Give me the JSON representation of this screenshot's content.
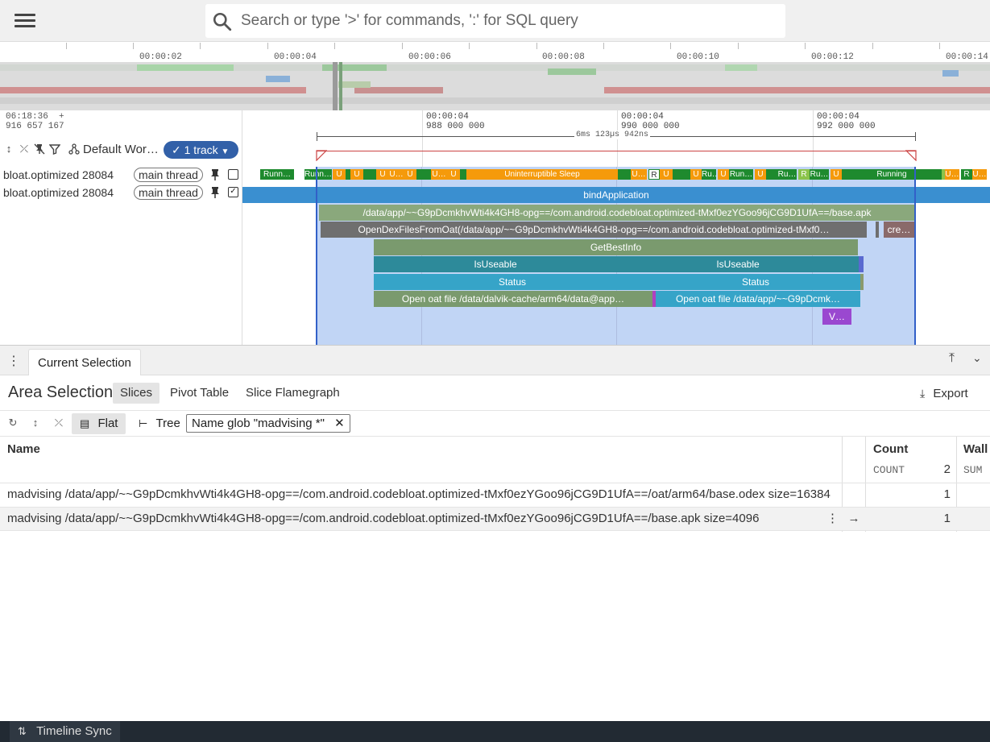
{
  "search": {
    "placeholder": "Search or type '>' for commands, ':' for SQL query"
  },
  "overview": {
    "time_labels": [
      "00:00:02",
      "00:00:04",
      "00:00:06",
      "00:00:08",
      "00:00:10",
      "00:00:12",
      "00:00:14"
    ]
  },
  "header": {
    "time_top": "06:18:36",
    "time_plus": "+",
    "time_ns": "916 657 167",
    "workspace": "Default Wor…",
    "tracks_pill": "1 track"
  },
  "ruler": {
    "labels": [
      {
        "l1": "00:00:04",
        "l2": "988 000 000"
      },
      {
        "l1": "00:00:04",
        "l2": "990 000 000"
      },
      {
        "l1": "00:00:04",
        "l2": "992 000 000"
      }
    ],
    "duration": "6ms 123µs 942ns"
  },
  "tracks": [
    {
      "name": "bloat.optimized 28084",
      "chip": "main thread",
      "checked": ""
    },
    {
      "name": "bloat.optimized 28084",
      "chip": "main thread",
      "checked": "✓"
    }
  ],
  "states": {
    "runn1": "Runn…",
    "runn2": "Runn…",
    "sleep": "Uninterruptible Sleep",
    "running": "Running",
    "u": "U",
    "r": "R",
    "ru": "Ru…",
    "run": "Run…",
    "uell": "U…"
  },
  "slices": {
    "bind": "bindApplication",
    "apk": "/data/app/~~G9pDcmkhvWti4k4GH8-opg==/com.android.codebloat.optimized-tMxf0ezYGoo96jCG9D1UfA==/base.apk",
    "opendex": "OpenDexFilesFromOat(/data/app/~~G9pDcmkhvWti4k4GH8-opg==/com.android.codebloat.optimized-tMxf0…",
    "cre": "cre…",
    "getbest": "GetBestInfo",
    "useable1": "IsUseable",
    "useable2": "IsUseable",
    "status1": "Status",
    "status2": "Status",
    "oat1": "Open oat file /data/dalvik-cache/arm64/data@app…",
    "oat2": "Open oat file /data/app/~~G9pDcmk…",
    "v": "V…"
  },
  "panel": {
    "tab": "Current Selection",
    "title": "Area Selection",
    "subtabs": [
      "Slices",
      "Pivot Table",
      "Slice Flamegraph"
    ],
    "export": "Export",
    "flat": "Flat",
    "tree": "Tree",
    "filter": "Name glob \"madvising *\""
  },
  "table": {
    "col_name": "Name",
    "col_count": "Count",
    "col_count_sub": "COUNT",
    "col_count_total": "2",
    "col_wall": "Wall",
    "col_wall_sub": "SUM",
    "rows": [
      {
        "name": "madvising /data/app/~~G9pDcmkhvWti4k4GH8-opg==/com.android.codebloat.optimized-tMxf0ezYGoo96jCG9D1UfA==/oat/arm64/base.odex size=16384",
        "count": "1"
      },
      {
        "name": "madvising /data/app/~~G9pDcmkhvWti4k4GH8-opg==/com.android.codebloat.optimized-tMxf0ezYGoo96jCG9D1UfA==/base.apk size=4096",
        "count": "1"
      }
    ]
  },
  "status": {
    "sync": "Timeline Sync"
  },
  "colors": {
    "accent": "#3260a8",
    "running": "#1e8a2e",
    "sleep": "#f59a0b",
    "selection": "#a0bef0"
  }
}
